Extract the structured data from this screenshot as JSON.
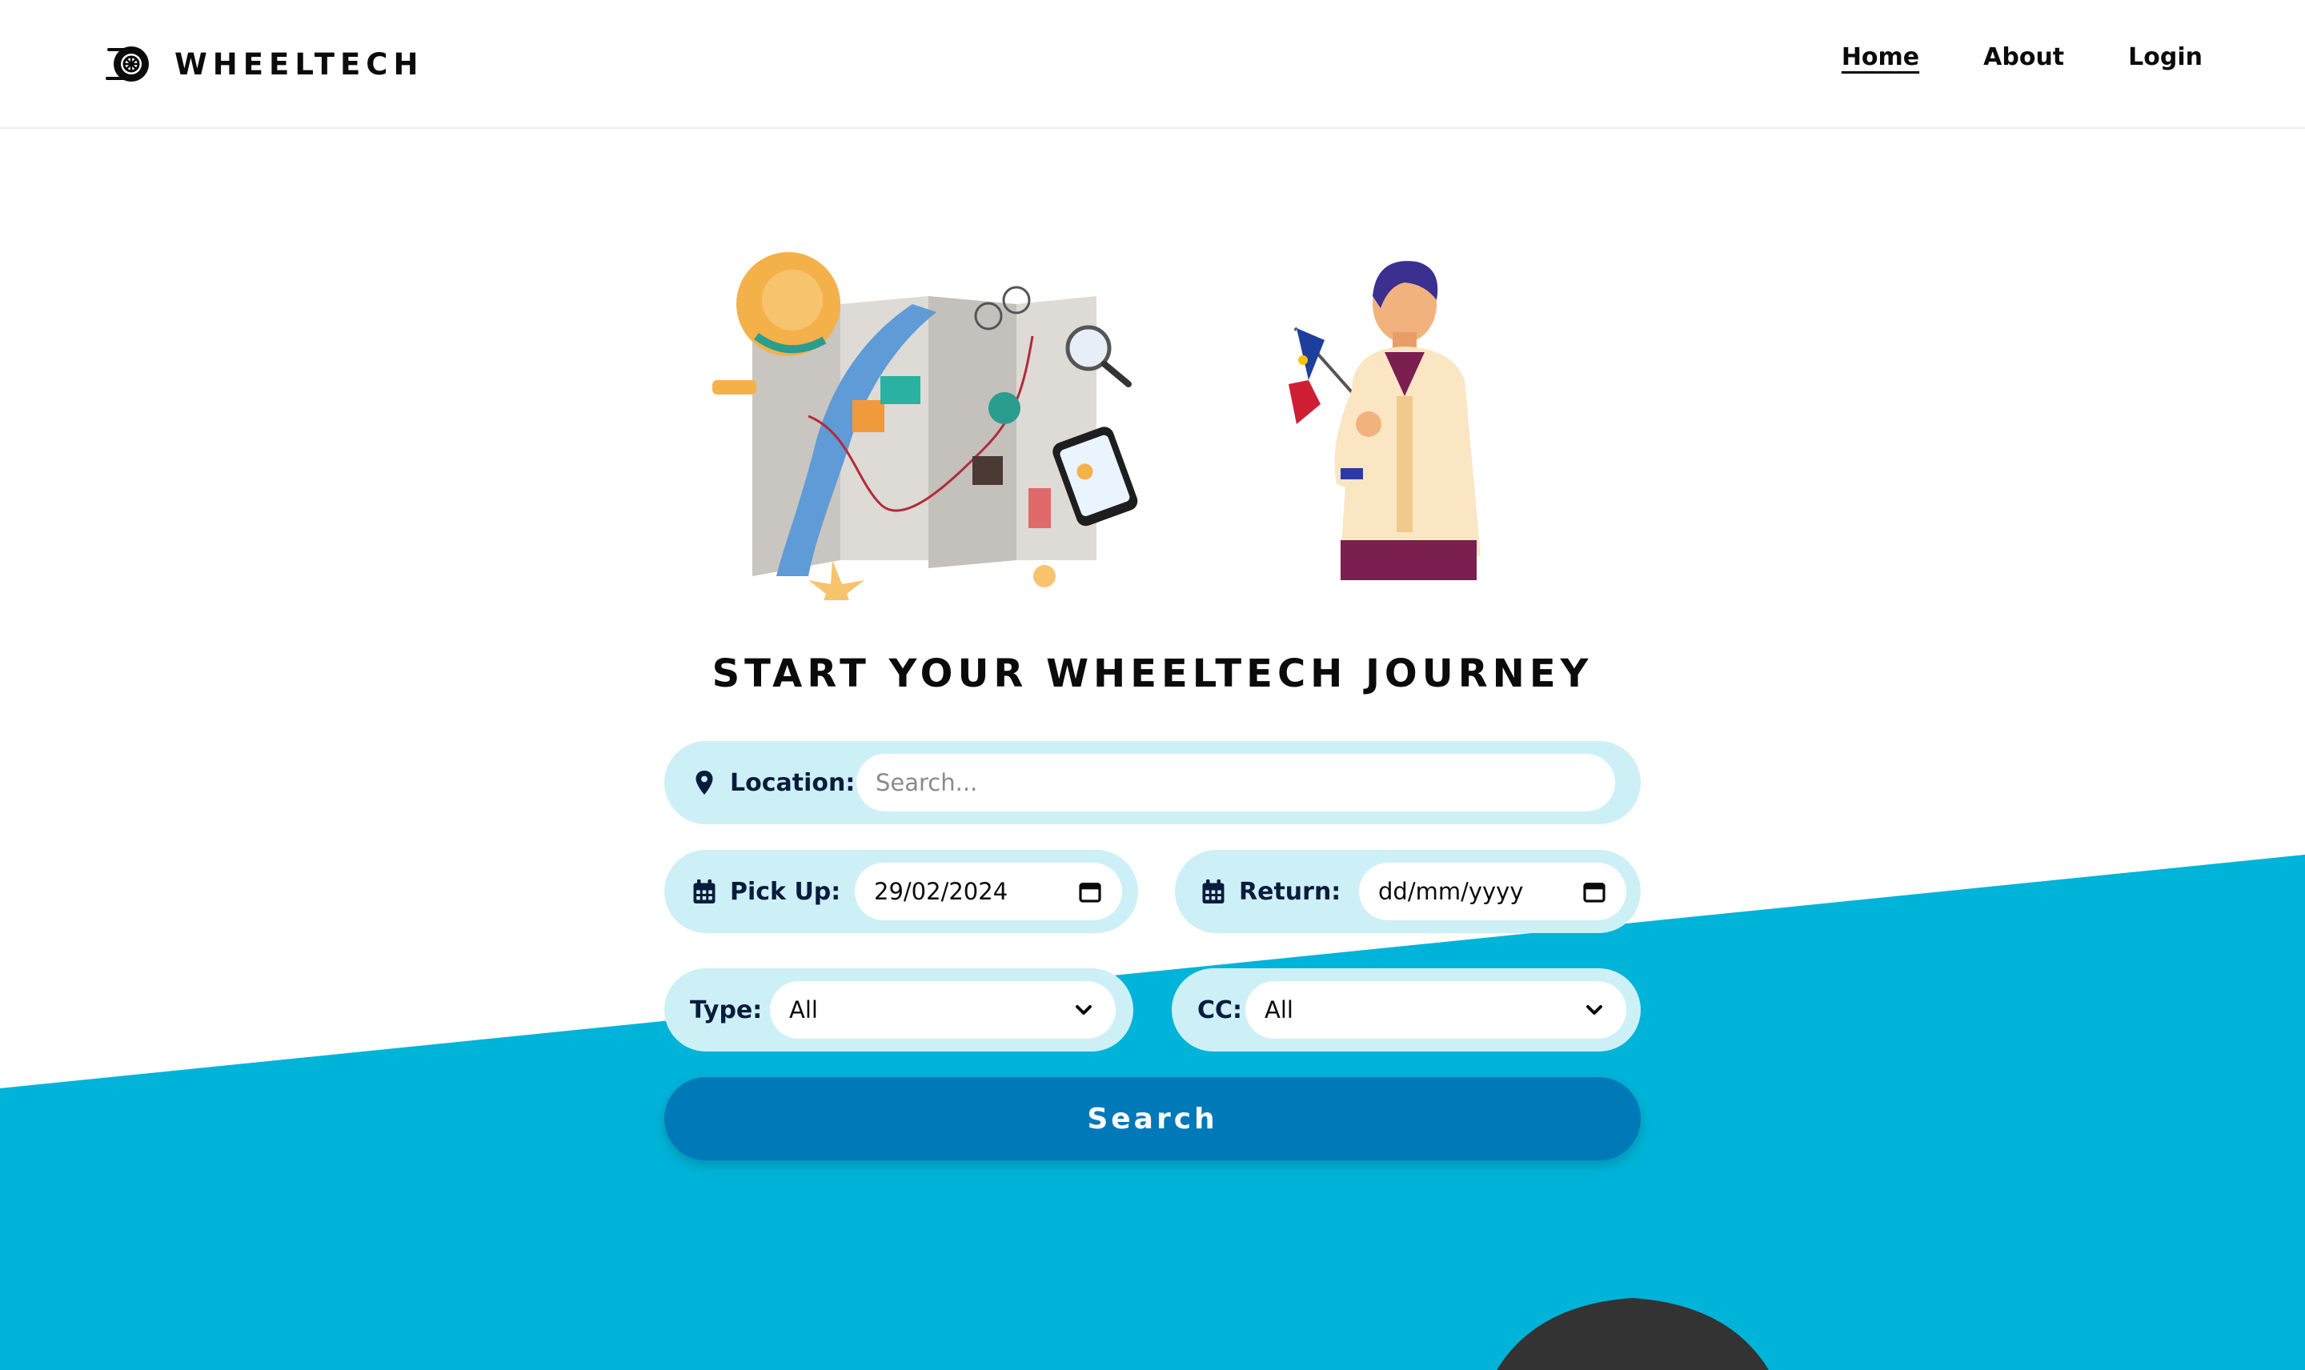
{
  "header": {
    "brand": "WHEELTECH",
    "nav": [
      {
        "label": "Home",
        "active": true
      },
      {
        "label": "About",
        "active": false
      },
      {
        "label": "Login",
        "active": false
      }
    ]
  },
  "hero": {
    "title": "START YOUR WHEELTECH JOURNEY"
  },
  "form": {
    "location": {
      "label": "Location:",
      "placeholder": "Search...",
      "icon": "map-pin-icon"
    },
    "pickup": {
      "label": "Pick Up:",
      "value": "29/02/2024",
      "icon": "calendar-icon"
    },
    "return": {
      "label": "Return:",
      "placeholder": "dd/mm/yyyy",
      "icon": "calendar-icon"
    },
    "type": {
      "label": "Type:",
      "selected": "All"
    },
    "cc": {
      "label": "CC:",
      "selected": "All"
    },
    "search_button": "Search"
  },
  "colors": {
    "accent_blue": "#00b3d8",
    "button_blue": "#0079b8",
    "pill_bg": "#cdf0f7",
    "label_navy": "#0a1c3d"
  }
}
